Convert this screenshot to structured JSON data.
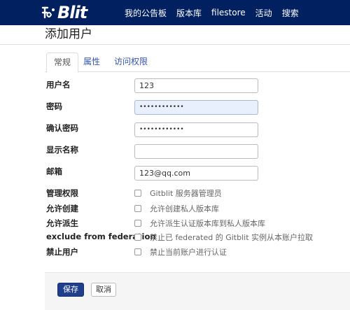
{
  "navbar": {
    "brand": "Blit",
    "links": [
      "我的公告板",
      "版本库",
      "filestore",
      "活动",
      "搜索"
    ]
  },
  "page": {
    "title": "添加用户"
  },
  "tabs": [
    "常规",
    "属性",
    "访问权限"
  ],
  "form": {
    "username": {
      "label": "用户名",
      "value": "123"
    },
    "password": {
      "label": "密码",
      "value": "••••••••••••"
    },
    "confirm_password": {
      "label": "确认密码",
      "value": "••••••••••••"
    },
    "display_name": {
      "label": "显示名称",
      "value": ""
    },
    "email": {
      "label": "邮箱",
      "value": "123@qq.com"
    },
    "checkboxes": [
      {
        "label": "管理权限",
        "text": "Gitblit 服务器管理员",
        "checked": false
      },
      {
        "label": "允许创建",
        "text": "允许创建私人版本库",
        "checked": false
      },
      {
        "label": "允许派生",
        "text": "允许派生认证版本库到私人版本库",
        "checked": false
      },
      {
        "label": "exclude from federation",
        "text": "禁止已 federated 的 Gitblit 实例从本账户拉取",
        "checked": false
      },
      {
        "label": "禁止用户",
        "text": "禁止当前账户进行认证",
        "checked": false
      }
    ]
  },
  "actions": {
    "save": "保存",
    "cancel": "取消"
  },
  "colors": {
    "navbar": "#002060",
    "primary_button": "#1f3f8c",
    "focused_input": "#e8f0fe"
  }
}
